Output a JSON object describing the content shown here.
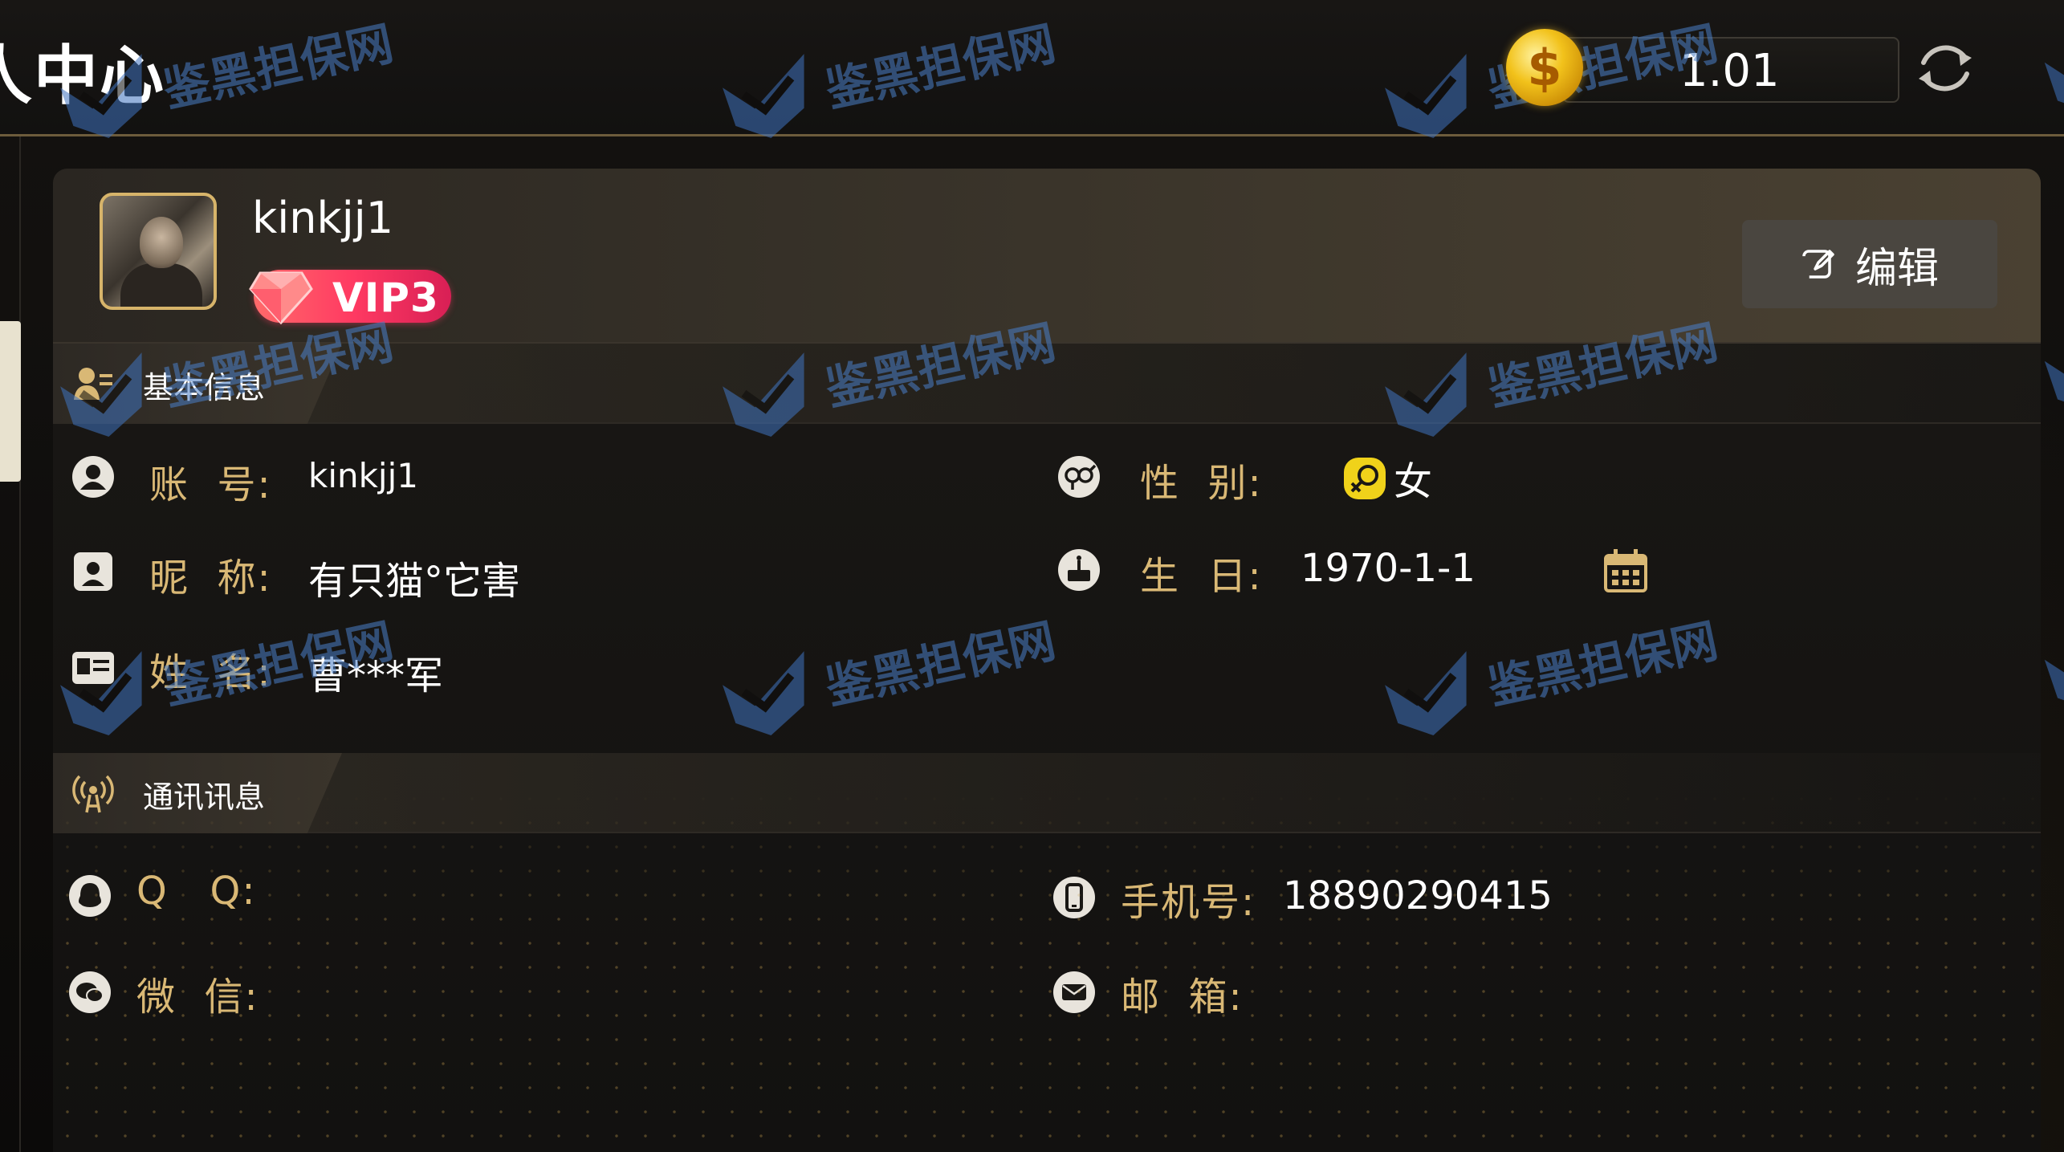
{
  "header": {
    "title": "人中心",
    "balance": "1.01",
    "coin_symbol": "$"
  },
  "profile": {
    "username": "kinkjj1",
    "vip_label": "VIP3",
    "edit_label": "编辑"
  },
  "basic_info": {
    "section_title": "基本信息",
    "account": {
      "label": "账  号:",
      "value": "kinkjj1"
    },
    "gender": {
      "label": "性  别:",
      "value": "女"
    },
    "nickname": {
      "label": "昵  称:",
      "value": "有只猫°它害"
    },
    "birthday": {
      "label": "生  日:",
      "value": "1970-1-1"
    },
    "real_name": {
      "label": "姓  名:",
      "value": "曹***军"
    }
  },
  "contact_info": {
    "section_title": "通讯讯息",
    "qq": {
      "label": "Q   Q:",
      "value": ""
    },
    "phone": {
      "label": "手机号:",
      "value": "18890290415"
    },
    "wechat": {
      "label": "微  信:",
      "value": ""
    },
    "email": {
      "label": "邮  箱:",
      "value": ""
    }
  },
  "watermark": {
    "text": "鉴黑担保网"
  },
  "colors": {
    "accent_gold": "#d9b875",
    "vip_pink": "#ff3a62",
    "watermark_blue": "#4a7fc8",
    "background": "#0d0c0b"
  }
}
